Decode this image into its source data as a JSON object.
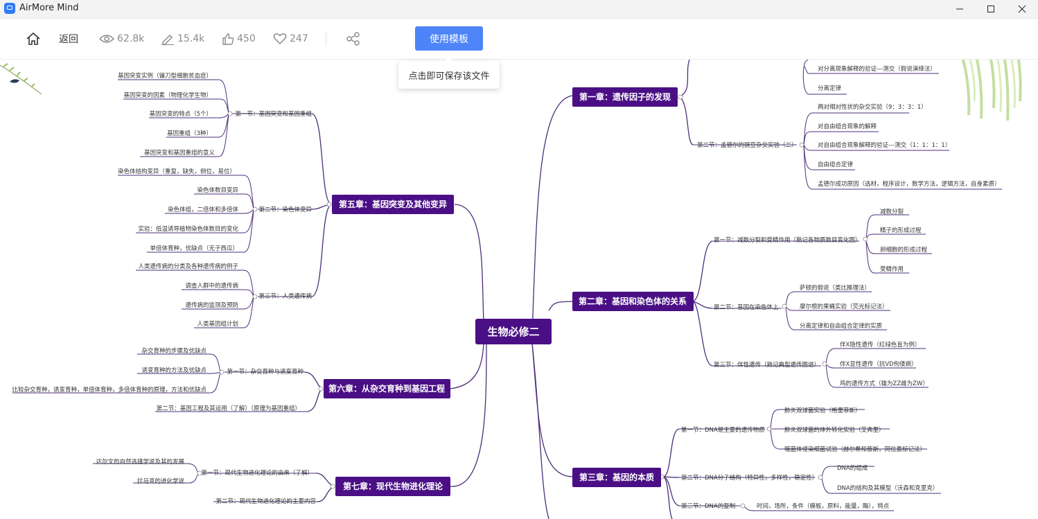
{
  "app": {
    "title": "AirMore Mind"
  },
  "toolbar": {
    "back_label": "返回",
    "views": "62.8k",
    "edits": "15.4k",
    "likes": "450",
    "favorites": "247",
    "use_template_label": "使用模板",
    "tooltip": "点击即可保存该文件"
  },
  "mindmap": {
    "root": "生物必修二",
    "ch1": {
      "title": "第一章：遗传因子的发现",
      "s1_leaves": [
        "对分离现象解释的验证---测交（假说演绎法）",
        "分离定律"
      ],
      "s2": "第二节：孟德尔的豌豆杂交实验（二）",
      "s2_leaves": [
        "两对相对性状的杂交实验（9：3：3：1）",
        "对自由组合现象的解释",
        "对自由组合现象解释的验证---测交（1：1：1：1）",
        "自由组合定律",
        "孟德尔成功原因（选材，程序设计，数学方法，逻辑方法，自身素质）"
      ]
    },
    "ch2": {
      "title": "第二章：基因和染色体的关系",
      "s1": "第一节：减数分裂和受精作用（熟记各物质数目变化图）",
      "s1_leaves": [
        "减数分裂",
        "精子的形成过程",
        "卵细胞的形成过程",
        "受精作用"
      ],
      "s2": "第二节：基因在染色体上",
      "s2_leaves": [
        "萨顿的假说（类比推理法）",
        "摩尔根的果蝇实验（荧光标记法）",
        "分离定律和自由组合定律的实质"
      ],
      "s3": "第三节：伴性遗传（熟记典型遗传图谱）",
      "s3_leaves": [
        "伴X隐性遗传（红绿色盲为例）",
        "伴X显性遗传（抗VD佝偻病）",
        "鸡的遗传方式（雄为ZZ雌为ZW）"
      ]
    },
    "ch3": {
      "title": "第三章：基因的本质",
      "s1": "第一节：DNA是主要的遗传物质",
      "s1_leaves": [
        "肺炎双球菌实验（格里菲斯）",
        "肺炎双球菌的体外转化实验（艾弗里）",
        "噬菌体侵染细菌试验（赫尔希和蔡斯，同位素标记法）"
      ],
      "s2": "第二节：DNA分子结构（特异性，多样性，稳定性）",
      "s2_leaves": [
        "DNA的组成",
        "DNA的结构及其模型（沃森和克里克）"
      ],
      "s3": "第三节：DNA的复制",
      "s3_leaves": [
        "时间，场所，条件（模板，原料，能量，酶），特点"
      ]
    },
    "ch5": {
      "title": "第五章：基因突变及其他变异",
      "s1": "第一节：基因突变和基因重组",
      "s1_leaves": [
        "基因突变实例（镰刀型细胞贫血症）",
        "基因突变的因素（物理化学生物）",
        "基因突变的特点（5个）",
        "基因重组（3种）",
        "基因突变和基因重组的意义"
      ],
      "s2": "第二节：染色体变异",
      "s2_leaves": [
        "染色体结构变异（重复，缺失，倒位，易位）",
        "染色体数目变异",
        "染色体组，二倍体和多倍体",
        "实验：低温诱导植物染色体数目的变化",
        "单倍体育种，优缺点（无子西瓜）"
      ],
      "s3": "第三节：人类遗传病",
      "s3_leaves": [
        "人类遗传病的分类及各种遗传病的例子",
        "调查人群中的遗传病",
        "遗传病的监测及预防",
        "人类基因组计划"
      ]
    },
    "ch6": {
      "title": "第六章：从杂交育种到基因工程",
      "s1": "第一节：杂交育种与诱变育种",
      "s1_leaves": [
        "杂交育种的步骤及优缺点",
        "诱变育种的方法及优缺点",
        "比较杂交育种，诱变育种，单倍体育种，多倍体育种的原理，方法和优缺点"
      ],
      "s2": "第二节：基因工程及其运用（了解）（原理为基因重组）"
    },
    "ch7": {
      "title": "第七章：现代生物进化理论",
      "s1": "第一节：现代生物进化理论的由来（了解）",
      "s1_leaves": [
        "达尔文的自然选择学说及其的发展",
        "拉马克的进化学说"
      ],
      "s2": "第二节：现代生物进化理论的主要内容"
    }
  }
}
